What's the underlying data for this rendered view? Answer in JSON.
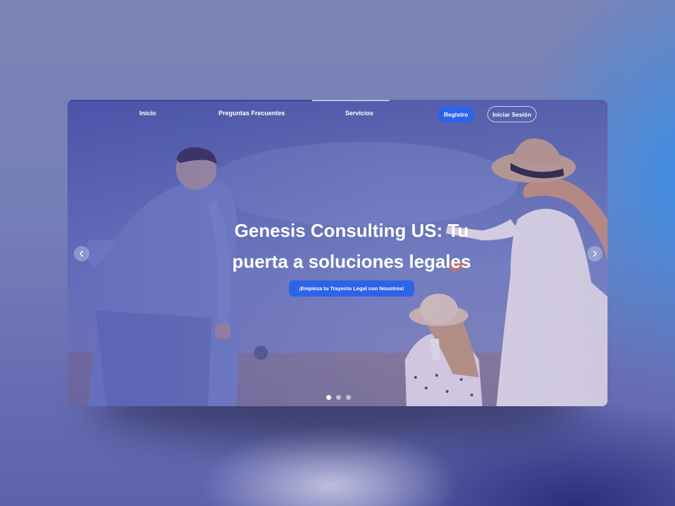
{
  "nav": {
    "links": [
      {
        "label": "Inicio"
      },
      {
        "label": "Preguntas Frecuentes"
      },
      {
        "label": "Servicios"
      }
    ],
    "register_label": "Registro",
    "login_label": "Iniciar Sesión"
  },
  "hero": {
    "headline_line1": "Genesis Consulting US: Tu",
    "headline_line2": "puerta a soluciones legales",
    "cta_label": "¡Empieza tu Trayecto Legal con Nosotros!",
    "image_description_icon": "family-in-wheat-field-photo",
    "prev_icon": "chevron-left-icon",
    "next_icon": "chevron-right-icon"
  },
  "carousel": {
    "slide_count": 3,
    "active_index": 0
  },
  "colors": {
    "accent": "#2d63e9",
    "overlay": "#4a50b0"
  }
}
